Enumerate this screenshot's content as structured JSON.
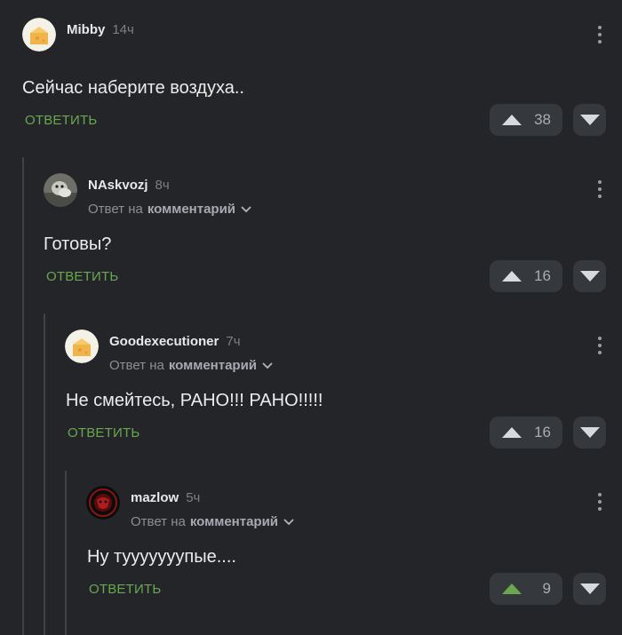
{
  "comments": [
    {
      "username": "Mibby",
      "time": "14ч",
      "text": "Сейчас наберите воздуха..",
      "reply_label": "ОТВЕТИТЬ",
      "rating": "38"
    },
    {
      "username": "NAskvozj",
      "time": "8ч",
      "reply_prefix": "Ответ на",
      "reply_target": "комментарий",
      "text": "Готовы?",
      "reply_label": "ОТВЕТИТЬ",
      "rating": "16"
    },
    {
      "username": "Goodexecutioner",
      "time": "7ч",
      "reply_prefix": "Ответ на",
      "reply_target": "комментарий",
      "text": "Не смейтесь, РАНО!!! РАНО!!!!!",
      "reply_label": "ОТВЕТИТЬ",
      "rating": "16"
    },
    {
      "username": "mazlow",
      "time": "5ч",
      "reply_prefix": "Ответ на",
      "reply_target": "комментарий",
      "text": "Ну тууууууупые....",
      "reply_label": "ОТВЕТИТЬ",
      "rating": "9"
    }
  ],
  "colors": {
    "background": "#232529",
    "reply_link": "#6aa84f",
    "upvoted_arrow": "#6aa84f",
    "button_bg": "#35383d"
  },
  "icons": {
    "upvote": "triangle-up-icon",
    "downvote": "triangle-down-icon",
    "more": "vertical-dots-icon",
    "reply_dropdown": "chevron-down-icon"
  }
}
